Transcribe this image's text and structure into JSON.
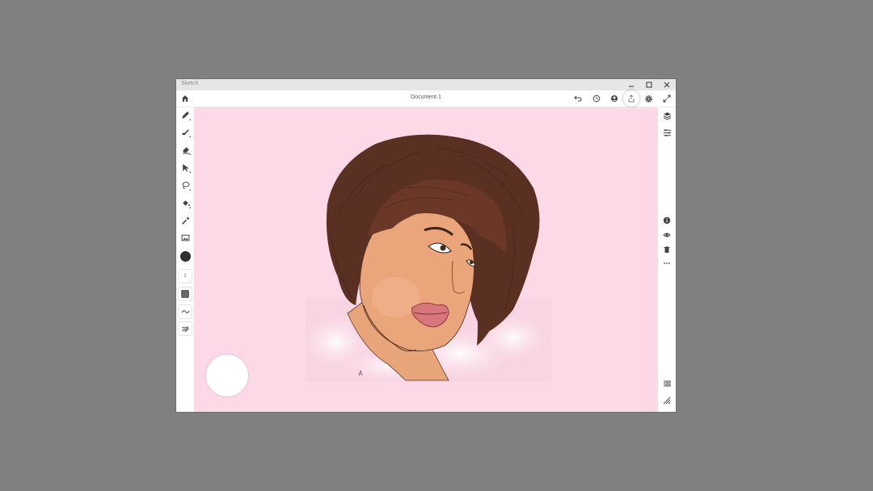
{
  "app": {
    "title": "Sketch"
  },
  "window_controls": {
    "minimize": "—",
    "maximize": "☐",
    "close": "✕"
  },
  "document": {
    "title": "Document 1"
  },
  "toolbar": {
    "icons": [
      "home-icon",
      "undo-icon",
      "timelapse-icon",
      "account-icon",
      "share-icon",
      "settings-icon",
      "fullscreen-icon"
    ]
  },
  "tools": {
    "icons": [
      "pencil-icon",
      "brush-icon",
      "eraser-icon",
      "select-arrow-icon",
      "lasso-icon",
      "fill-icon",
      "eyedropper-icon",
      "image-icon",
      "color-swatch",
      "brush-size",
      "opacity",
      "smoothing-icon",
      "pressure-icon"
    ],
    "brush_size_value": "1",
    "color": "#2e2e2e"
  },
  "layers_panel": {
    "icons": [
      "layers-icon",
      "layer-properties-icon",
      "info-icon",
      "visibility-icon",
      "delete-icon",
      "more-icon",
      "merge-icon",
      "resize-icon"
    ]
  },
  "colors": {
    "canvas_bg": "#fdd8e6",
    "hair": "#5a3022",
    "skin": "#e8a67a",
    "lips": "#d9767c"
  }
}
